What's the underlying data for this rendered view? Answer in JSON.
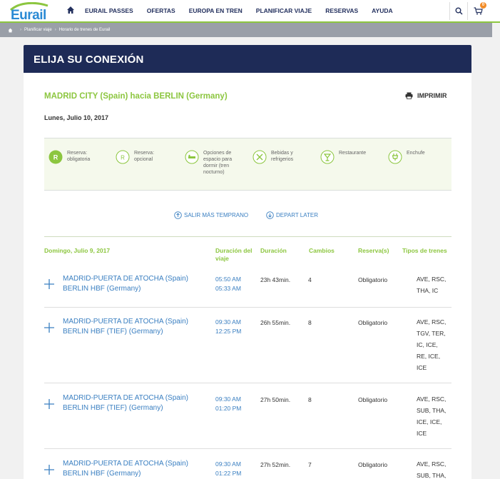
{
  "header": {
    "logo_text": "Eurail",
    "nav": [
      "EURAIL PASSES",
      "OFERTAS",
      "EUROPA EN TREN",
      "PLANIFICAR VIAJE",
      "RESERVAS",
      "AYUDA"
    ],
    "cart_count": "0",
    "accent_green": "#8cc63f",
    "brand_navy": "#1e2b57"
  },
  "breadcrumb": [
    "Planificar viaje",
    "Horario de trenes de Eurail"
  ],
  "card": {
    "title": "ELIJA SU CONEXIÓN",
    "route": "MADRID CITY (Spain) hacia BERLIN (Germany)",
    "print_label": "IMPRIMIR",
    "date": "Lunes, Julio 10, 2017"
  },
  "legend": [
    {
      "icon": "reservation-mandatory-icon",
      "lines": [
        "Reserva:",
        "obligatoria"
      ]
    },
    {
      "icon": "reservation-optional-icon",
      "lines": [
        "Reserva:",
        "opcional"
      ]
    },
    {
      "icon": "sleeper-icon",
      "lines": [
        "Opciones de",
        "espacio para",
        "dormir (tren",
        "nocturno)"
      ]
    },
    {
      "icon": "drinks-icon",
      "lines": [
        "Bebidas y",
        "refrigerios"
      ]
    },
    {
      "icon": "restaurant-icon",
      "lines": [
        "Restaurante"
      ]
    },
    {
      "icon": "power-plug-icon",
      "lines": [
        "Enchufe"
      ]
    }
  ],
  "controls": {
    "earlier": "SALIR MÁS TEMPRANO",
    "later": "DEPART LATER"
  },
  "table": {
    "date_header": "Domingo, Julio 9, 2017",
    "col_trip_duration": [
      "Duración del",
      "viaje"
    ],
    "col_duration": "Duración",
    "col_changes": "Cambios",
    "col_reservations": "Reserva(s)",
    "col_train_types": "Tipos de trenes",
    "rows": [
      {
        "from": "MADRID-PUERTA DE ATOCHA (Spain)",
        "to": "BERLIN HBF (Germany)",
        "depart": "05:50 AM",
        "arrive": "05:33 AM",
        "duration": "23h 43min.",
        "changes": "4",
        "reservation": "Obligatorio",
        "types": [
          "AVE, RSC,",
          "THA, IC"
        ]
      },
      {
        "from": "MADRID-PUERTA DE ATOCHA (Spain)",
        "to": "BERLIN HBF (TIEF) (Germany)",
        "depart": "09:30 AM",
        "arrive": "12:25 PM",
        "duration": "26h 55min.",
        "changes": "8",
        "reservation": "Obligatorio",
        "types": [
          "AVE, RSC,",
          "TGV, TER,",
          "IC, ICE,",
          "RE, ICE,",
          "ICE"
        ]
      },
      {
        "from": "MADRID-PUERTA DE ATOCHA (Spain)",
        "to": "BERLIN HBF (TIEF) (Germany)",
        "depart": "09:30 AM",
        "arrive": "01:20 PM",
        "duration": "27h 50min.",
        "changes": "8",
        "reservation": "Obligatorio",
        "types": [
          "AVE, RSC,",
          "SUB, THA,",
          "ICE, ICE,",
          "ICE"
        ]
      },
      {
        "from": "MADRID-PUERTA DE ATOCHA (Spain)",
        "to": "BERLIN HBF (Germany)",
        "depart": "09:30 AM",
        "arrive": "01:22 PM",
        "duration": "27h 52min.",
        "changes": "7",
        "reservation": "Obligatorio",
        "types": [
          "AVE, RSC,",
          "SUB, THA,"
        ]
      }
    ]
  }
}
